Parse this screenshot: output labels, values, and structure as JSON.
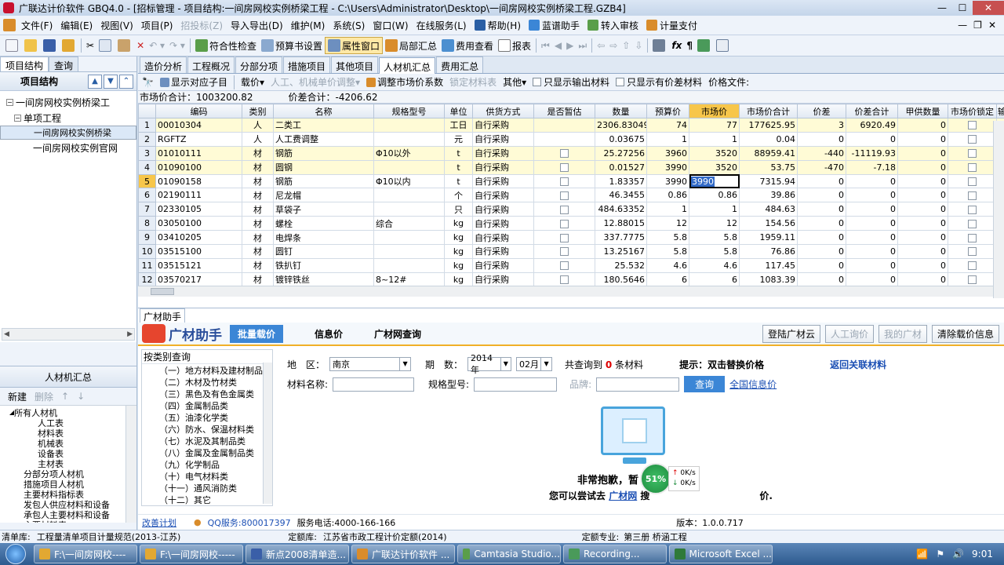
{
  "window": {
    "title": "广联达计价软件 GBQ4.0 - [招标管理 - 项目结构:一间房网校实例桥梁工程 - C:\\Users\\Administrator\\Desktop\\一间房网校实例桥梁工程.GZB4]",
    "min": "—",
    "max": "☐",
    "close": "✕",
    "mdi_min": "—",
    "mdi_restore": "❐",
    "mdi_close": "✕"
  },
  "menu": [
    "文件(F)",
    "编辑(E)",
    "视图(V)",
    "项目(P)",
    "招投标(Z)",
    "导入导出(D)",
    "维护(M)",
    "系统(S)",
    "窗口(W)",
    "在线服务(L)",
    "帮助(H)",
    "蓝谱助手",
    "转入审核",
    "计量支付"
  ],
  "toolbar": {
    "check": "符合性检查",
    "preview": "预算书设置",
    "property": "属性窗口",
    "local": "局部汇总",
    "fee": "费用查看",
    "report": "报表"
  },
  "left": {
    "tabs": [
      "项目结构",
      "查询"
    ],
    "header": "项目结构",
    "tree": [
      "一间房网校实例桥梁工",
      "单项工程",
      "一间房网校实例桥梁",
      "一间房网校实例官网"
    ],
    "section": "人材机汇总",
    "new": "新建",
    "del": "删除",
    "tree2": [
      "所有人材机",
      "人工表",
      "材料表",
      "机械表",
      "设备表",
      "主材表",
      "分部分项人材机",
      "措施项目人材机",
      "主要材料指标表",
      "发包人供应材料和设备",
      "承包人主要材料和设备",
      "主要材料表",
      "暂估材料表"
    ]
  },
  "tabs": [
    "造价分析",
    "工程概况",
    "分部分项",
    "措施项目",
    "其他项目",
    "人材机汇总",
    "费用汇总"
  ],
  "subtool": {
    "show": "显示对应子目",
    "price": "载价",
    "adjust": "人工、机械单价调整",
    "coef": "调整市场价系数",
    "lock": "锁定材料表",
    "other": "其他",
    "out": "只显示输出材料",
    "diff": "只显示有价差材料",
    "doc": "价格文件:"
  },
  "summary": {
    "market": "市场价合计：1003200.82",
    "diff": "价差合计：-4206.62"
  },
  "grid": {
    "headers": [
      "编码",
      "类别",
      "名称",
      "规格型号",
      "单位",
      "供货方式",
      "是否暂估",
      "数量",
      "预算价",
      "市场价",
      "市场价合计",
      "价差",
      "价差合计",
      "甲供数量",
      "市场价锁定",
      "输"
    ],
    "rows": [
      {
        "n": "1",
        "code": "00010304",
        "cat": "人",
        "name": "二类工",
        "spec": "",
        "unit": "工日",
        "supply": "自行采购",
        "est": false,
        "qty": "2306.83049",
        "budget": "74",
        "market": "77",
        "total": "177625.95",
        "diff": "3",
        "dtotal": "6920.49",
        "jia": "0"
      },
      {
        "n": "2",
        "code": "RGFTZ",
        "cat": "人",
        "name": "人工费调整",
        "spec": "",
        "unit": "元",
        "supply": "自行采购",
        "est": false,
        "qty": "0.03675",
        "budget": "1",
        "market": "1",
        "total": "0.04",
        "diff": "0",
        "dtotal": "0",
        "jia": "0"
      },
      {
        "n": "3",
        "code": "01010111",
        "cat": "材",
        "name": "钢筋",
        "spec": "Φ10以外",
        "unit": "t",
        "supply": "自行采购",
        "est": true,
        "qty": "25.27256",
        "budget": "3960",
        "market": "3520",
        "total": "88959.41",
        "diff": "-440",
        "dtotal": "-11119.93",
        "jia": "0"
      },
      {
        "n": "4",
        "code": "01090100",
        "cat": "材",
        "name": "圆钢",
        "spec": "",
        "unit": "t",
        "supply": "自行采购",
        "est": true,
        "qty": "0.01527",
        "budget": "3990",
        "market": "3520",
        "total": "53.75",
        "diff": "-470",
        "dtotal": "-7.18",
        "jia": "0"
      },
      {
        "n": "5",
        "code": "01090158",
        "cat": "材",
        "name": "钢筋",
        "spec": "Φ10以内",
        "unit": "t",
        "supply": "自行采购",
        "est": true,
        "qty": "1.83357",
        "budget": "3990",
        "market": "3990",
        "total": "7315.94",
        "diff": "0",
        "dtotal": "0",
        "jia": "0"
      },
      {
        "n": "6",
        "code": "02190111",
        "cat": "材",
        "name": "尼龙帽",
        "spec": "",
        "unit": "个",
        "supply": "自行采购",
        "est": true,
        "qty": "46.3455",
        "budget": "0.86",
        "market": "0.86",
        "total": "39.86",
        "diff": "0",
        "dtotal": "0",
        "jia": "0"
      },
      {
        "n": "7",
        "code": "02330105",
        "cat": "材",
        "name": "草袋子",
        "spec": "",
        "unit": "只",
        "supply": "自行采购",
        "est": true,
        "qty": "484.63352",
        "budget": "1",
        "market": "1",
        "total": "484.63",
        "diff": "0",
        "dtotal": "0",
        "jia": "0"
      },
      {
        "n": "8",
        "code": "03050100",
        "cat": "材",
        "name": "螺栓",
        "spec": "综合",
        "unit": "kg",
        "supply": "自行采购",
        "est": true,
        "qty": "12.88015",
        "budget": "12",
        "market": "12",
        "total": "154.56",
        "diff": "0",
        "dtotal": "0",
        "jia": "0"
      },
      {
        "n": "9",
        "code": "03410205",
        "cat": "材",
        "name": "电焊条",
        "spec": "",
        "unit": "kg",
        "supply": "自行采购",
        "est": true,
        "qty": "337.7775",
        "budget": "5.8",
        "market": "5.8",
        "total": "1959.11",
        "diff": "0",
        "dtotal": "0",
        "jia": "0"
      },
      {
        "n": "10",
        "code": "03515100",
        "cat": "材",
        "name": "圆钉",
        "spec": "",
        "unit": "kg",
        "supply": "自行采购",
        "est": true,
        "qty": "13.25167",
        "budget": "5.8",
        "market": "5.8",
        "total": "76.86",
        "diff": "0",
        "dtotal": "0",
        "jia": "0"
      },
      {
        "n": "11",
        "code": "03515121",
        "cat": "材",
        "name": "铁扒钉",
        "spec": "",
        "unit": "kg",
        "supply": "自行采购",
        "est": true,
        "qty": "25.532",
        "budget": "4.6",
        "market": "4.6",
        "total": "117.45",
        "diff": "0",
        "dtotal": "0",
        "jia": "0"
      },
      {
        "n": "12",
        "code": "03570217",
        "cat": "材",
        "name": "镀锌铁丝",
        "spec": "8~12#",
        "unit": "kg",
        "supply": "自行采购",
        "est": true,
        "qty": "180.5646",
        "budget": "6",
        "market": "6",
        "total": "1083.39",
        "diff": "0",
        "dtotal": "0",
        "jia": "0"
      }
    ]
  },
  "assist": {
    "tab": "广材助手",
    "logo": "广材助手",
    "batch": "批量载价",
    "t1": "信息价",
    "t2": "广材网查询",
    "login": "登陆广材云",
    "labor": "人工询价",
    "mine": "我的广材",
    "clear": "清除载价信息",
    "cathead": "按类别查询",
    "cats": [
      "（一）地方材料及建材制品",
      "（二）木材及竹材类",
      "（三）黑色及有色金属类",
      "（四）金属制品类",
      "（五）油漆化学类",
      "（六）防水、保温材料类",
      "（七）水泥及其制品类",
      "（八）金属及金属制品类",
      "（九）化学制品",
      "（十）电气材料类",
      "（十一）通风消防类",
      "（十二）其它"
    ],
    "region": "地　区：",
    "city": "南京",
    "period": "期　数：",
    "year": "2014年",
    "month": "02月",
    "found1": "共查询到",
    "found0": "0",
    "found2": "条材料",
    "tip": "提示：双击替换价格",
    "back": "返回关联材料",
    "mname": "材料名称:",
    "mspec": "规格型号:",
    "brand": "品牌:",
    "query": "查询",
    "national": "全国信息价",
    "sorry": "非常抱歉，暂",
    "sorry2a": "您可以尝试去",
    "sorry2b": "广材网",
    "sorry2c": "搜",
    "sorry2d": "价.",
    "speed": "51%",
    "up": "0K/s",
    "down": "0K/s",
    "improve": "改善计划",
    "qq": "QQ服务:800017397",
    "phone": "服务电话:4000-166-166",
    "ver": "版本：1.0.0.717"
  },
  "status": {
    "list": "清单库:",
    "listv": "工程量清单项目计量规范(2013-江苏)",
    "quota": "定额库:",
    "quotav": "江苏省市政工程计价定额(2014)",
    "major": "定额专业:",
    "majorv": "第三册 桥涵工程"
  },
  "taskbar": [
    "F:\\一间房网校----",
    "F:\\一间房网校-----",
    "新点2008清单造...",
    "广联达计价软件 ...",
    "Camtasia Studio...",
    "Recording...",
    "Microsoft Excel ..."
  ],
  "clock": "9:01",
  "colors": {
    "accent": "#f7c64a",
    "brand": "#2a4e9b",
    "highlight": "#fffbd6"
  }
}
